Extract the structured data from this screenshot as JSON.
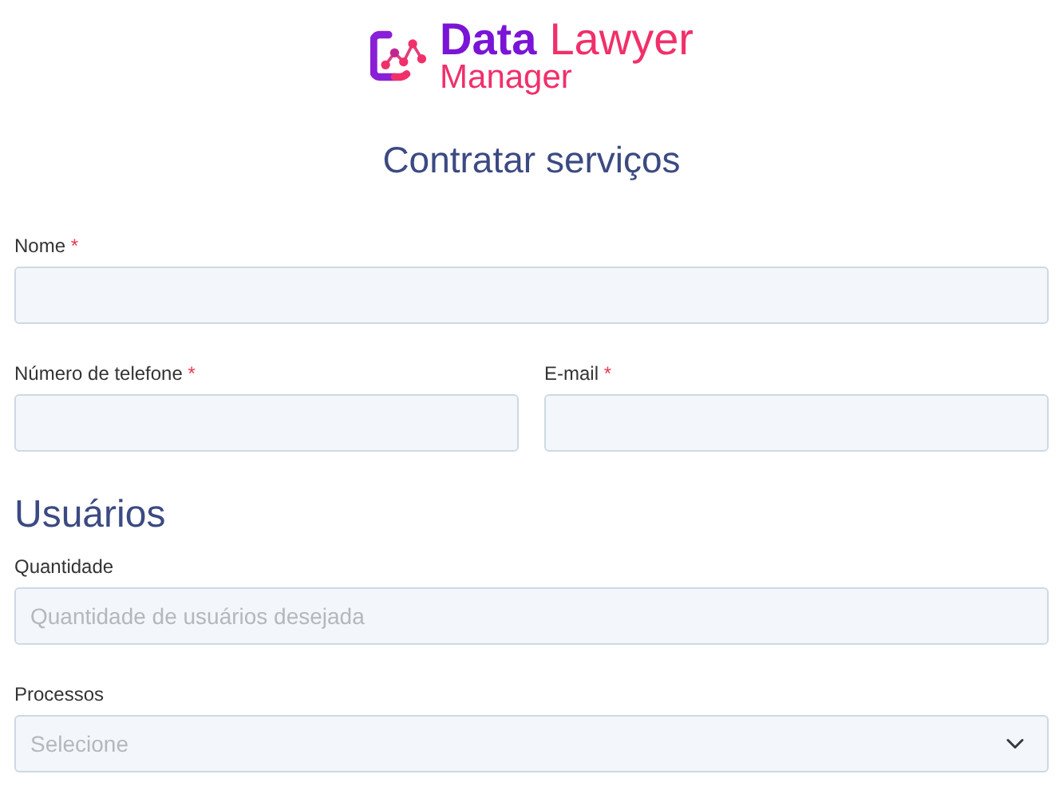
{
  "logo": {
    "word_1": "Data",
    "word_2": "Lawyer",
    "word_3": "Manager"
  },
  "title": "Contratar serviços",
  "rows": [
    [
      {
        "kind": "input",
        "label": "Nome",
        "required_mark": "*"
      }
    ],
    [
      {
        "kind": "input",
        "label": "Número de telefone",
        "required_mark": "*"
      },
      {
        "kind": "input",
        "label": "E-mail",
        "required_mark": "*"
      }
    ]
  ],
  "section": {
    "heading": "Usuários",
    "rows": [
      [
        {
          "kind": "input",
          "label": "Quantidade",
          "placeholder": "Quantidade de usuários desejada"
        }
      ],
      [
        {
          "kind": "select",
          "label": "Processos",
          "placeholder": "Selecione"
        }
      ]
    ]
  }
}
